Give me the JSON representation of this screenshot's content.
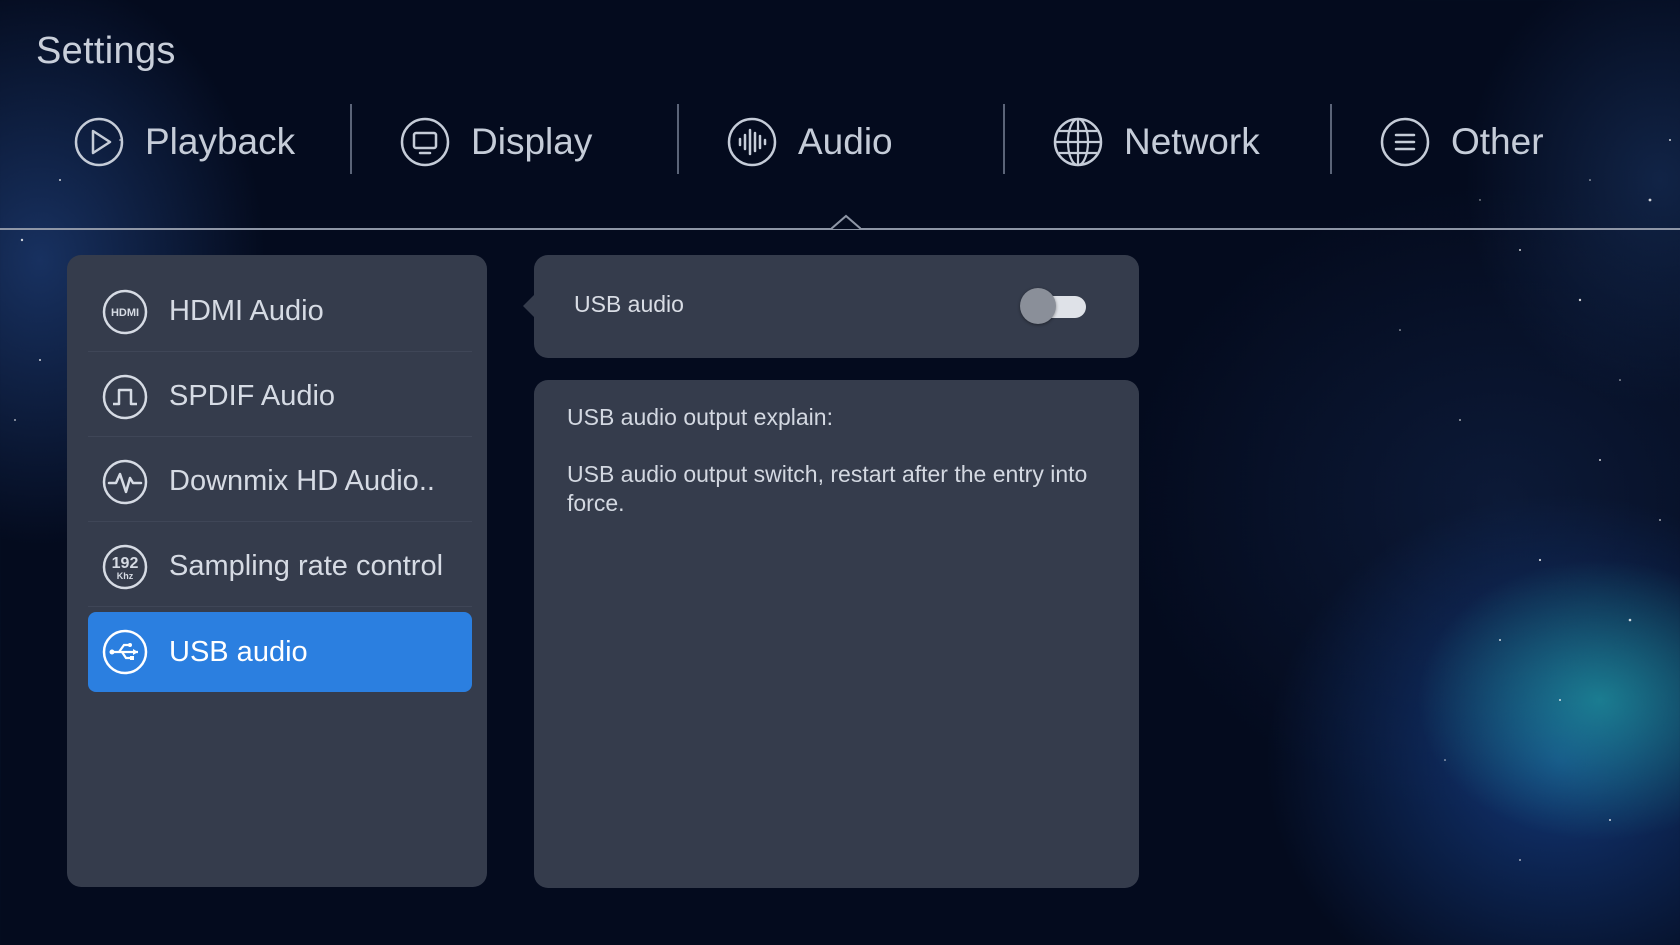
{
  "header": {
    "title": "Settings"
  },
  "tabs": [
    {
      "label": "Playback",
      "icon": "play-icon"
    },
    {
      "label": "Display",
      "icon": "monitor-icon"
    },
    {
      "label": "Audio",
      "icon": "audio-wave-icon"
    },
    {
      "label": "Network",
      "icon": "globe-icon"
    },
    {
      "label": "Other",
      "icon": "menu-icon"
    }
  ],
  "active_tab": "Audio",
  "sidebar": {
    "items": [
      {
        "label": "HDMI Audio",
        "icon": "hdmi-icon"
      },
      {
        "label": "SPDIF Audio",
        "icon": "spdif-icon"
      },
      {
        "label": "Downmix HD Audio..",
        "icon": "waveform-icon"
      },
      {
        "label": "Sampling rate control",
        "icon": "sampling-rate-icon",
        "icon_text_top": "192",
        "icon_text_bottom": "Khz"
      },
      {
        "label": "USB audio",
        "icon": "usb-icon"
      }
    ],
    "selected": "USB audio"
  },
  "detail": {
    "setting_label": "USB audio",
    "toggle_on": false,
    "explain_title": "USB audio output explain:",
    "explain_text": "USB audio output switch, restart after the entry into force."
  },
  "colors": {
    "background": "#040b1e",
    "panel": "#353c4c",
    "selected": "#2b7fe0",
    "text": "#d6dbe4"
  }
}
